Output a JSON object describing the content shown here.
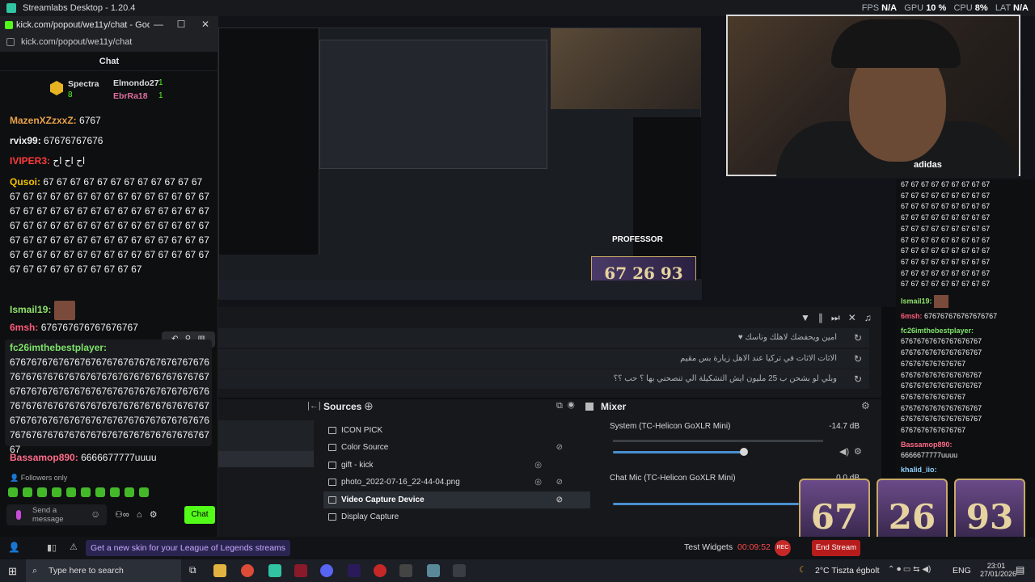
{
  "app": {
    "title": "Streamlabs Desktop - 1.20.4"
  },
  "stats": {
    "fps_label": "FPS",
    "fps": "N/A",
    "gpu_label": "GPU",
    "gpu": "10 %",
    "cpu_label": "CPU",
    "cpu": "8%",
    "lat_label": "LAT",
    "lat": "N/A"
  },
  "browser": {
    "title": "kick.com/popout/we11y/chat - Google Chr...",
    "url": "kick.com/popout/we11y/chat"
  },
  "chat": {
    "header": "Chat",
    "top": [
      {
        "name": "Spectra",
        "count": "8"
      },
      {
        "name": "Elmondo27",
        "count": "1"
      },
      {
        "name": "EbrRa18",
        "count": "1"
      }
    ],
    "messages": [
      {
        "user": "MazenXZzxxZ:",
        "text": "6767",
        "color": "#e8a24a"
      },
      {
        "user": "rvix99:",
        "text": "67676767676",
        "color": "#ffffff"
      },
      {
        "user": "IVIPER3:",
        "text": "اح اح اح",
        "color": "#ff3b3b"
      },
      {
        "user": "Qusoi:",
        "text": "67 67 67 67 67 67 67 67 67 67 67 67 67 67 67 67 67 67 67 67 67 67 67 67 67 67 67 67 67 67 67 67 67 67 67 67 67 67 67 67 67 67 67 67 67 67 67 67 67 67 67 67 67 67 67 67 67 67 67 67 67 67 67 67 67 67 67 67 67 67 67 67 67 67 67 67 67 67 67 67 67 67 67 67 67 67 67 67 67 67 67 67 67 67 67 67 67",
        "color": "#f2c200"
      },
      {
        "user": "Ismail19:",
        "text": "",
        "color": "#8fe36b"
      },
      {
        "user": "6msh:",
        "text": "676767676767676767",
        "color": "#ff5a7a"
      },
      {
        "user": "fc26imthebestplayer:",
        "text": "67676767676767676767676767676767676767676767676767676767676767676767676767676767676767676767676767676767676767676767676767676767676767676767676767676767676767676767676767676767676767676767676767676767676767676767676767676767",
        "color": "#7ee36b"
      },
      {
        "user": "Bassamop890:",
        "text": "6666677777uuuu",
        "color": "#ff6b8a"
      }
    ],
    "followers_only": "Followers only",
    "send_placeholder": "Send a message",
    "chat_button": "Chat"
  },
  "rightchat": {
    "lines": [
      "67 67 67 67 67 67 67 67 67",
      "67 67 67 67 67 67 67 67 67",
      "67 67 67 67 67 67 67 67 67",
      "67 67 67 67 67 67 67 67 67",
      "67 67 67 67 67 67 67 67 67",
      "67 67 67 67 67 67 67 67 67",
      "67 67 67 67 67 67 67 67 67",
      "67 67 67 67 67 67 67 67 67",
      "67 67 67 67 67 67 67 67 67",
      "67 67 67 67 67 67 67 67 67"
    ],
    "ismail": "Ismail19:",
    "msh_user": "6msh:",
    "msh_text": "676767676767676767",
    "fc_user": "fc26imthebestplayer:",
    "fc_lines": [
      "67676767676767676767",
      "67676767676767676767",
      "6767676767676767",
      "67676767676767676767",
      "67676767676767676767",
      "6767676767676767",
      "67676767676767676767",
      "67676767676767676767",
      "6767676767676767"
    ],
    "bassam_user": "Bassamop890:",
    "bassam_text": "6666677777uuuu",
    "khalid_user": "khalid_iio:"
  },
  "activity": {
    "rows": [
      "امين ويحفضك لاهلك وناسك ♥",
      "الاثات الاثات في تركيا عند الاهل زيارة بس مقيم",
      "وبلي لو بشحن ب 25 مليون ايش التشكيلة الي تنصحني بها ؟ حب ؟؟"
    ]
  },
  "sources": {
    "title": "Sources",
    "items": [
      "ICON PICK",
      "Color Source",
      "gift - kick",
      "photo_2022-07-16_22-44-04.png",
      "Video Capture Device",
      "Display Capture"
    ],
    "selected": 4
  },
  "mixer": {
    "title": "Mixer",
    "channels": [
      {
        "name": "System (TC-Helicon GoXLR Mini)",
        "db": "-14.7 dB",
        "level": 0.62
      },
      {
        "name": "Chat Mic (TC-Helicon GoXLR Mini)",
        "db": "0.0 dB",
        "level": 1.0
      }
    ]
  },
  "cards": {
    "values": [
      "67",
      "26",
      "93"
    ]
  },
  "overlay": {
    "professor": "PROFESSOR"
  },
  "bottom": {
    "promo": "Get a new skin for your League of Legends streams",
    "test_widgets": "Test Widgets",
    "timer": "00:09:52",
    "rec": "REC",
    "end_stream": "End Stream"
  },
  "taskbar": {
    "search": "Type here to search",
    "weather": "2°C  Tiszta égbolt",
    "lang": "ENG",
    "time": "23:01",
    "date": "27/01/2026"
  }
}
